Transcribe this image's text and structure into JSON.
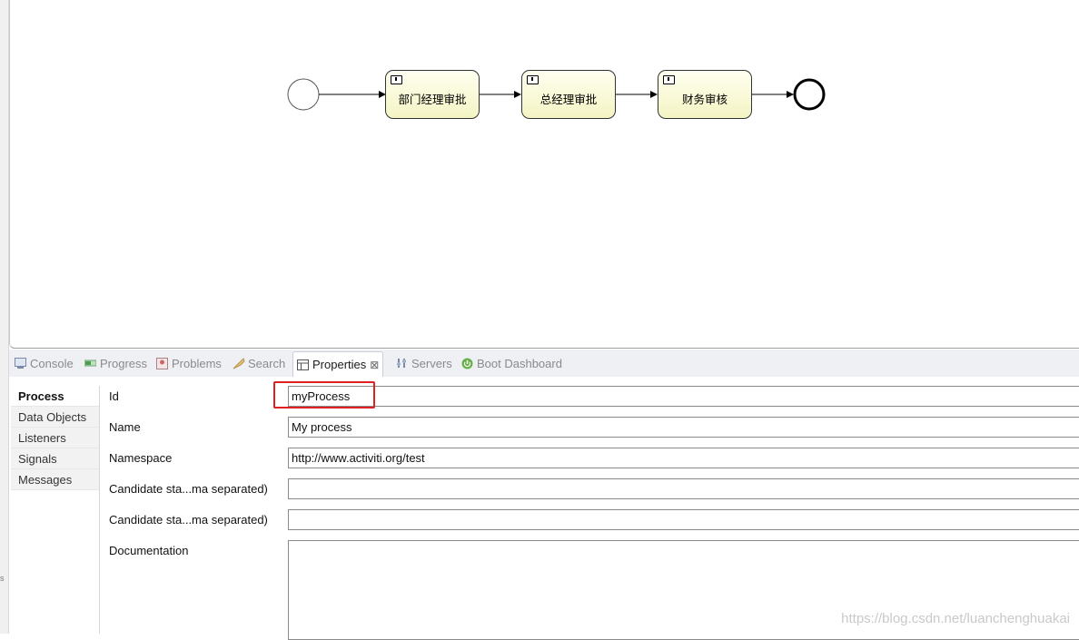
{
  "diagram": {
    "tasks": [
      {
        "label": "部门经理审批"
      },
      {
        "label": "总经理审批"
      },
      {
        "label": "财务审核"
      }
    ]
  },
  "tabs": [
    {
      "label": "Console",
      "icon": "console-icon"
    },
    {
      "label": "Progress",
      "icon": "progress-icon"
    },
    {
      "label": "Problems",
      "icon": "problems-icon"
    },
    {
      "label": "Search",
      "icon": "search-icon"
    },
    {
      "label": "Properties",
      "icon": "properties-icon",
      "active": true,
      "close": "⊠"
    },
    {
      "label": "Servers",
      "icon": "servers-icon"
    },
    {
      "label": "Boot Dashboard",
      "icon": "boot-dashboard-icon"
    }
  ],
  "sidebar": {
    "items": [
      {
        "label": "Process",
        "selected": true
      },
      {
        "label": "Data Objects"
      },
      {
        "label": "Listeners"
      },
      {
        "label": "Signals"
      },
      {
        "label": "Messages"
      }
    ]
  },
  "form": {
    "id": {
      "label": "Id",
      "value": "myProcess"
    },
    "name": {
      "label": "Name",
      "value": "My process"
    },
    "namespace": {
      "label": "Namespace",
      "value": "http://www.activiti.org/test"
    },
    "candidate1": {
      "label": "Candidate sta...ma separated)",
      "value": ""
    },
    "candidate2": {
      "label": "Candidate sta...ma separated)",
      "value": ""
    },
    "documentation": {
      "label": "Documentation",
      "value": ""
    }
  },
  "watermark": "https://blog.csdn.net/luanchenghuakai",
  "gutter_mark": "s"
}
